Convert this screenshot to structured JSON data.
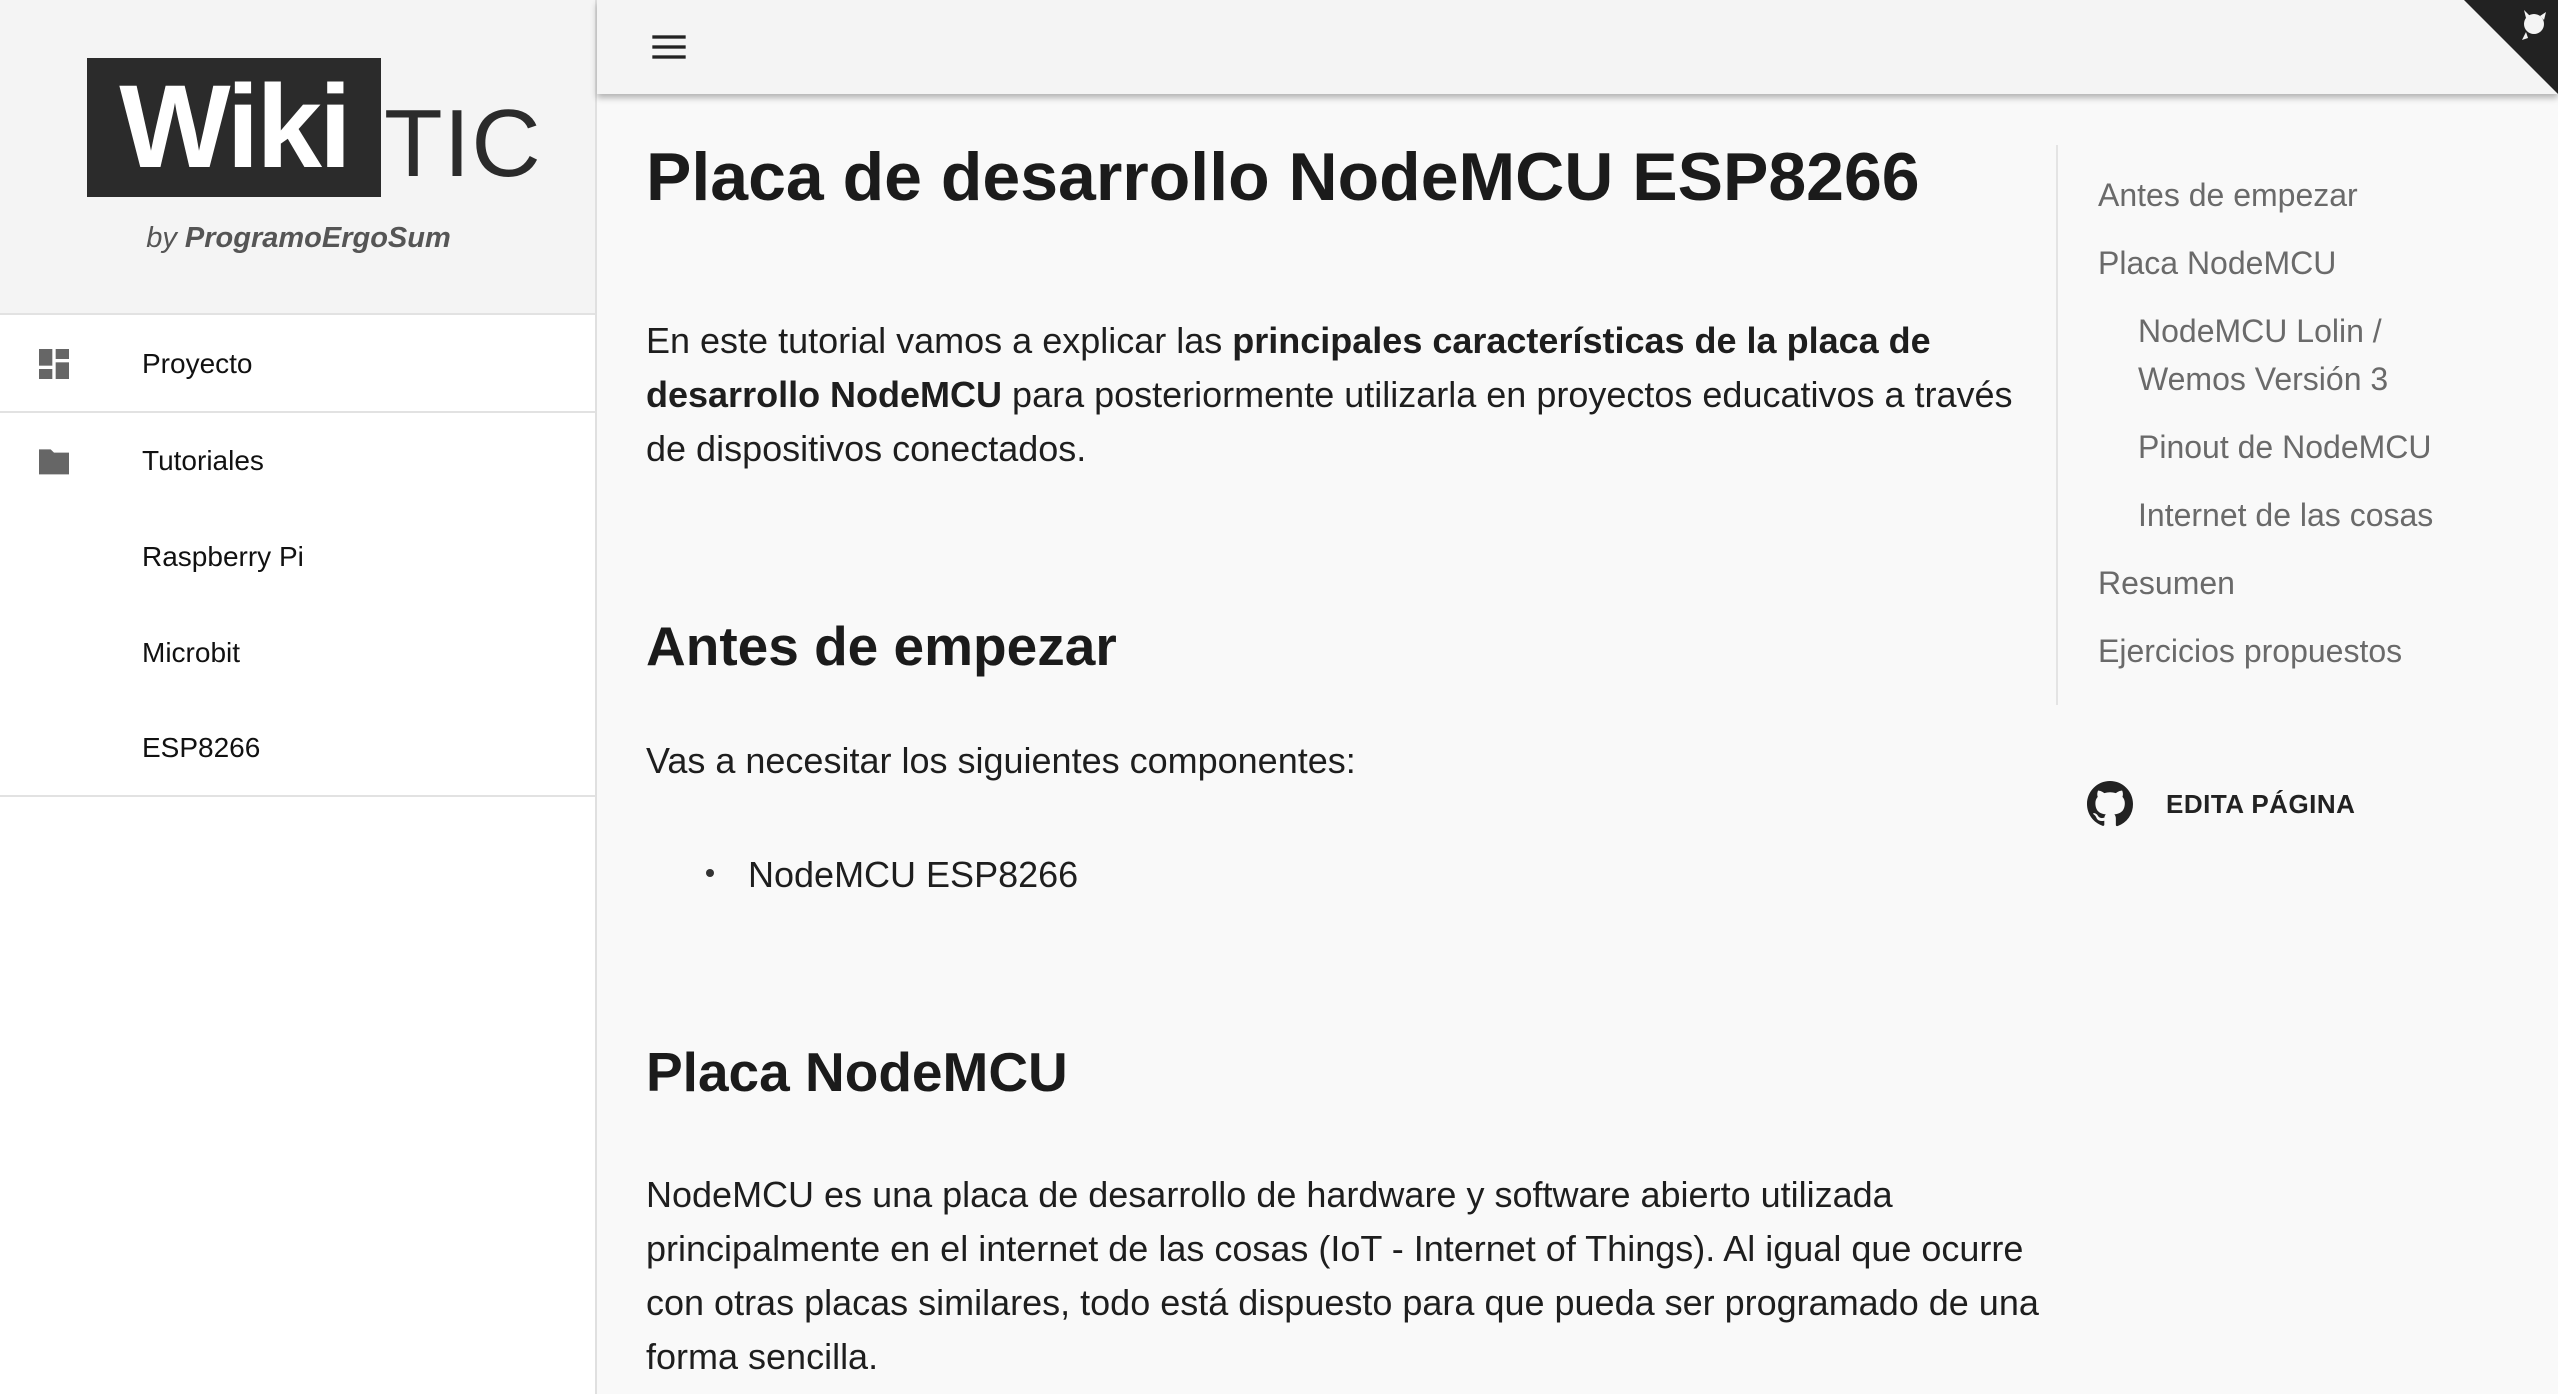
{
  "brand": {
    "logo_word": "Wiki",
    "logo_suffix": "TIC",
    "byline_prefix": "by",
    "byline_name": "ProgramoErgoSum"
  },
  "sidebar": {
    "items": [
      {
        "label": "Proyecto",
        "icon": "dashboard-icon"
      },
      {
        "label": "Tutoriales",
        "icon": "folder-icon"
      },
      {
        "label": "Raspberry Pi"
      },
      {
        "label": "Microbit"
      },
      {
        "label": "ESP8266"
      }
    ]
  },
  "header": {
    "menu_icon": "hamburger-menu-icon",
    "corner_icon": "github-octocat-icon"
  },
  "main": {
    "title": "Placa de desarrollo NodeMCU ESP8266",
    "intro": {
      "pre": "En este tutorial vamos a explicar las ",
      "bold": "principales características de la placa de desarrollo NodeMCU",
      "post": " para posteriormente utilizarla en proyectos educativos a través de dispositivos conectados."
    },
    "section1_title": "Antes de empezar",
    "section1_text": "Vas a necesitar los siguientes componentes:",
    "components": [
      "NodeMCU ESP8266"
    ],
    "section2_title": "Placa NodeMCU",
    "section2_text": "NodeMCU es una placa de desarrollo de hardware y software abierto utilizada principalmente en el internet de las cosas (IoT - Internet of Things). Al igual que ocurre con otras placas similares, todo está dispuesto para que pueda ser programado de una forma sencilla."
  },
  "toc": {
    "items": [
      "Antes de empezar",
      "Placa NodeMCU",
      "NodeMCU Lolin /",
      "Wemos Versión 3",
      "Pinout de NodeMCU",
      "Internet de las cosas",
      "Resumen",
      "Ejercicios propuestos"
    ]
  },
  "edit": {
    "label": "EDITA PÁGINA",
    "icon": "github-icon"
  },
  "colors": {
    "logo_bg": "#2b2b2b",
    "header_bg": "#f4f4f4",
    "page_bg": "#f9f9f9",
    "toc_text": "#6a6a6a"
  }
}
